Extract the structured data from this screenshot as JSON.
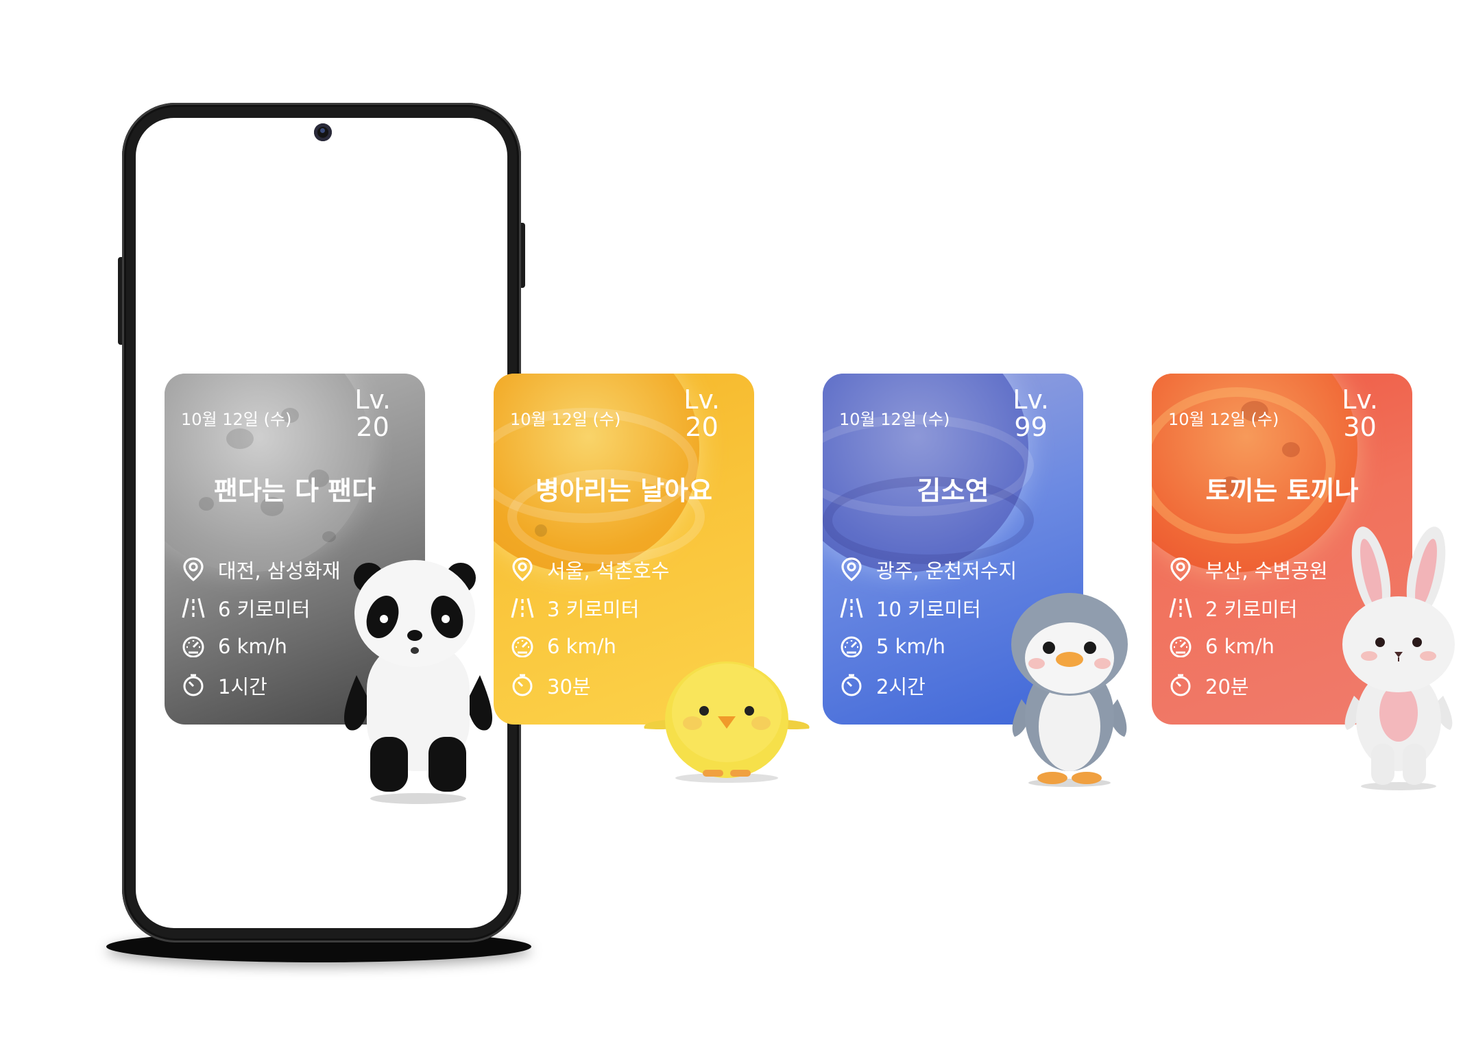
{
  "cards": [
    {
      "date": "10월 12일 (수)",
      "lv_label": "Lv.",
      "lv_value": "20",
      "name": "팬다는 다 팬다",
      "location": "대전, 삼성화재",
      "distance": "6 키로미터",
      "speed": "6 km/h",
      "duration": "1시간",
      "character": "panda",
      "color": "#8d8d8d"
    },
    {
      "date": "10월 12일 (수)",
      "lv_label": "Lv.",
      "lv_value": "20",
      "name": "병아리는 날아요",
      "location": "서울, 석촌호수",
      "distance": "3 키로미터",
      "speed": "6 km/h",
      "duration": "30분",
      "character": "chick",
      "color": "#f9c43a"
    },
    {
      "date": "10월 12일 (수)",
      "lv_label": "Lv.",
      "lv_value": "99",
      "name": "김소연",
      "location": "광주, 운천저수지",
      "distance": "10 키로미터",
      "speed": "5 km/h",
      "duration": "2시간",
      "character": "penguin",
      "color": "#5b7be0"
    },
    {
      "date": "10월 12일 (수)",
      "lv_label": "Lv.",
      "lv_value": "30",
      "name": "토끼는 토끼나",
      "location": "부산, 수변공원",
      "distance": "2 키로미터",
      "speed": "6 km/h",
      "duration": "20분",
      "character": "rabbit",
      "color": "#f07060"
    }
  ],
  "icons": {
    "location": "location-pin-icon",
    "distance": "road-icon",
    "speed": "speedometer-icon",
    "duration": "timer-icon"
  }
}
